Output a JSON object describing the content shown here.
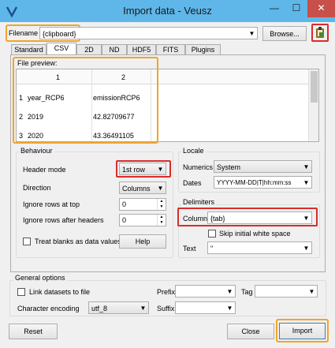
{
  "window": {
    "title": "Import data - Veusz"
  },
  "file": {
    "label": "Filename",
    "value": "{clipboard}",
    "browse_label": "Browse..."
  },
  "tabs": [
    "Standard",
    "CSV",
    "2D",
    "ND",
    "HDF5",
    "FITS",
    "Plugins"
  ],
  "preview": {
    "label": "File preview:",
    "columns": [
      "1",
      "2"
    ],
    "rows": [
      {
        "n": "1",
        "c1": "year_RCP6",
        "c2": "emissionRCP6"
      },
      {
        "n": "2",
        "c1": "2019",
        "c2": "42.82709677"
      },
      {
        "n": "3",
        "c1": "2020",
        "c2": "43.36491105"
      }
    ]
  },
  "behaviour": {
    "title": "Behaviour",
    "header_mode_label": "Header mode",
    "header_mode_value": "1st row",
    "direction_label": "Direction",
    "direction_value": "Columns",
    "ignore_top_label": "Ignore rows at top",
    "ignore_top_value": "0",
    "ignore_after_label": "Ignore rows after headers",
    "ignore_after_value": "0",
    "blanks_label": "Treat blanks as data values",
    "help_label": "Help"
  },
  "locale": {
    "title": "Locale",
    "numerics_label": "Numerics",
    "numerics_value": "System",
    "dates_label": "Dates",
    "dates_value": "YYYY-MM-DD|T|hh:mm:ss"
  },
  "delimiters": {
    "title": "Delimiters",
    "column_label": "Column",
    "column_value": "{tab}",
    "skip_ws_label": "Skip initial white space",
    "text_label": "Text",
    "text_value": "\""
  },
  "general": {
    "title": "General options",
    "link_label": "Link datasets to file",
    "prefix_label": "Prefix",
    "tag_label": "Tag",
    "encoding_label": "Character encoding",
    "encoding_value": "utf_8",
    "suffix_label": "Suffix"
  },
  "buttons": {
    "reset": "Reset",
    "close": "Close",
    "import": "Import"
  },
  "colors": {
    "titlebar": "#5fb6e8",
    "close_button": "#c7504a",
    "highlight_orange": "#f0a52b",
    "highlight_red": "#d92c2c"
  }
}
